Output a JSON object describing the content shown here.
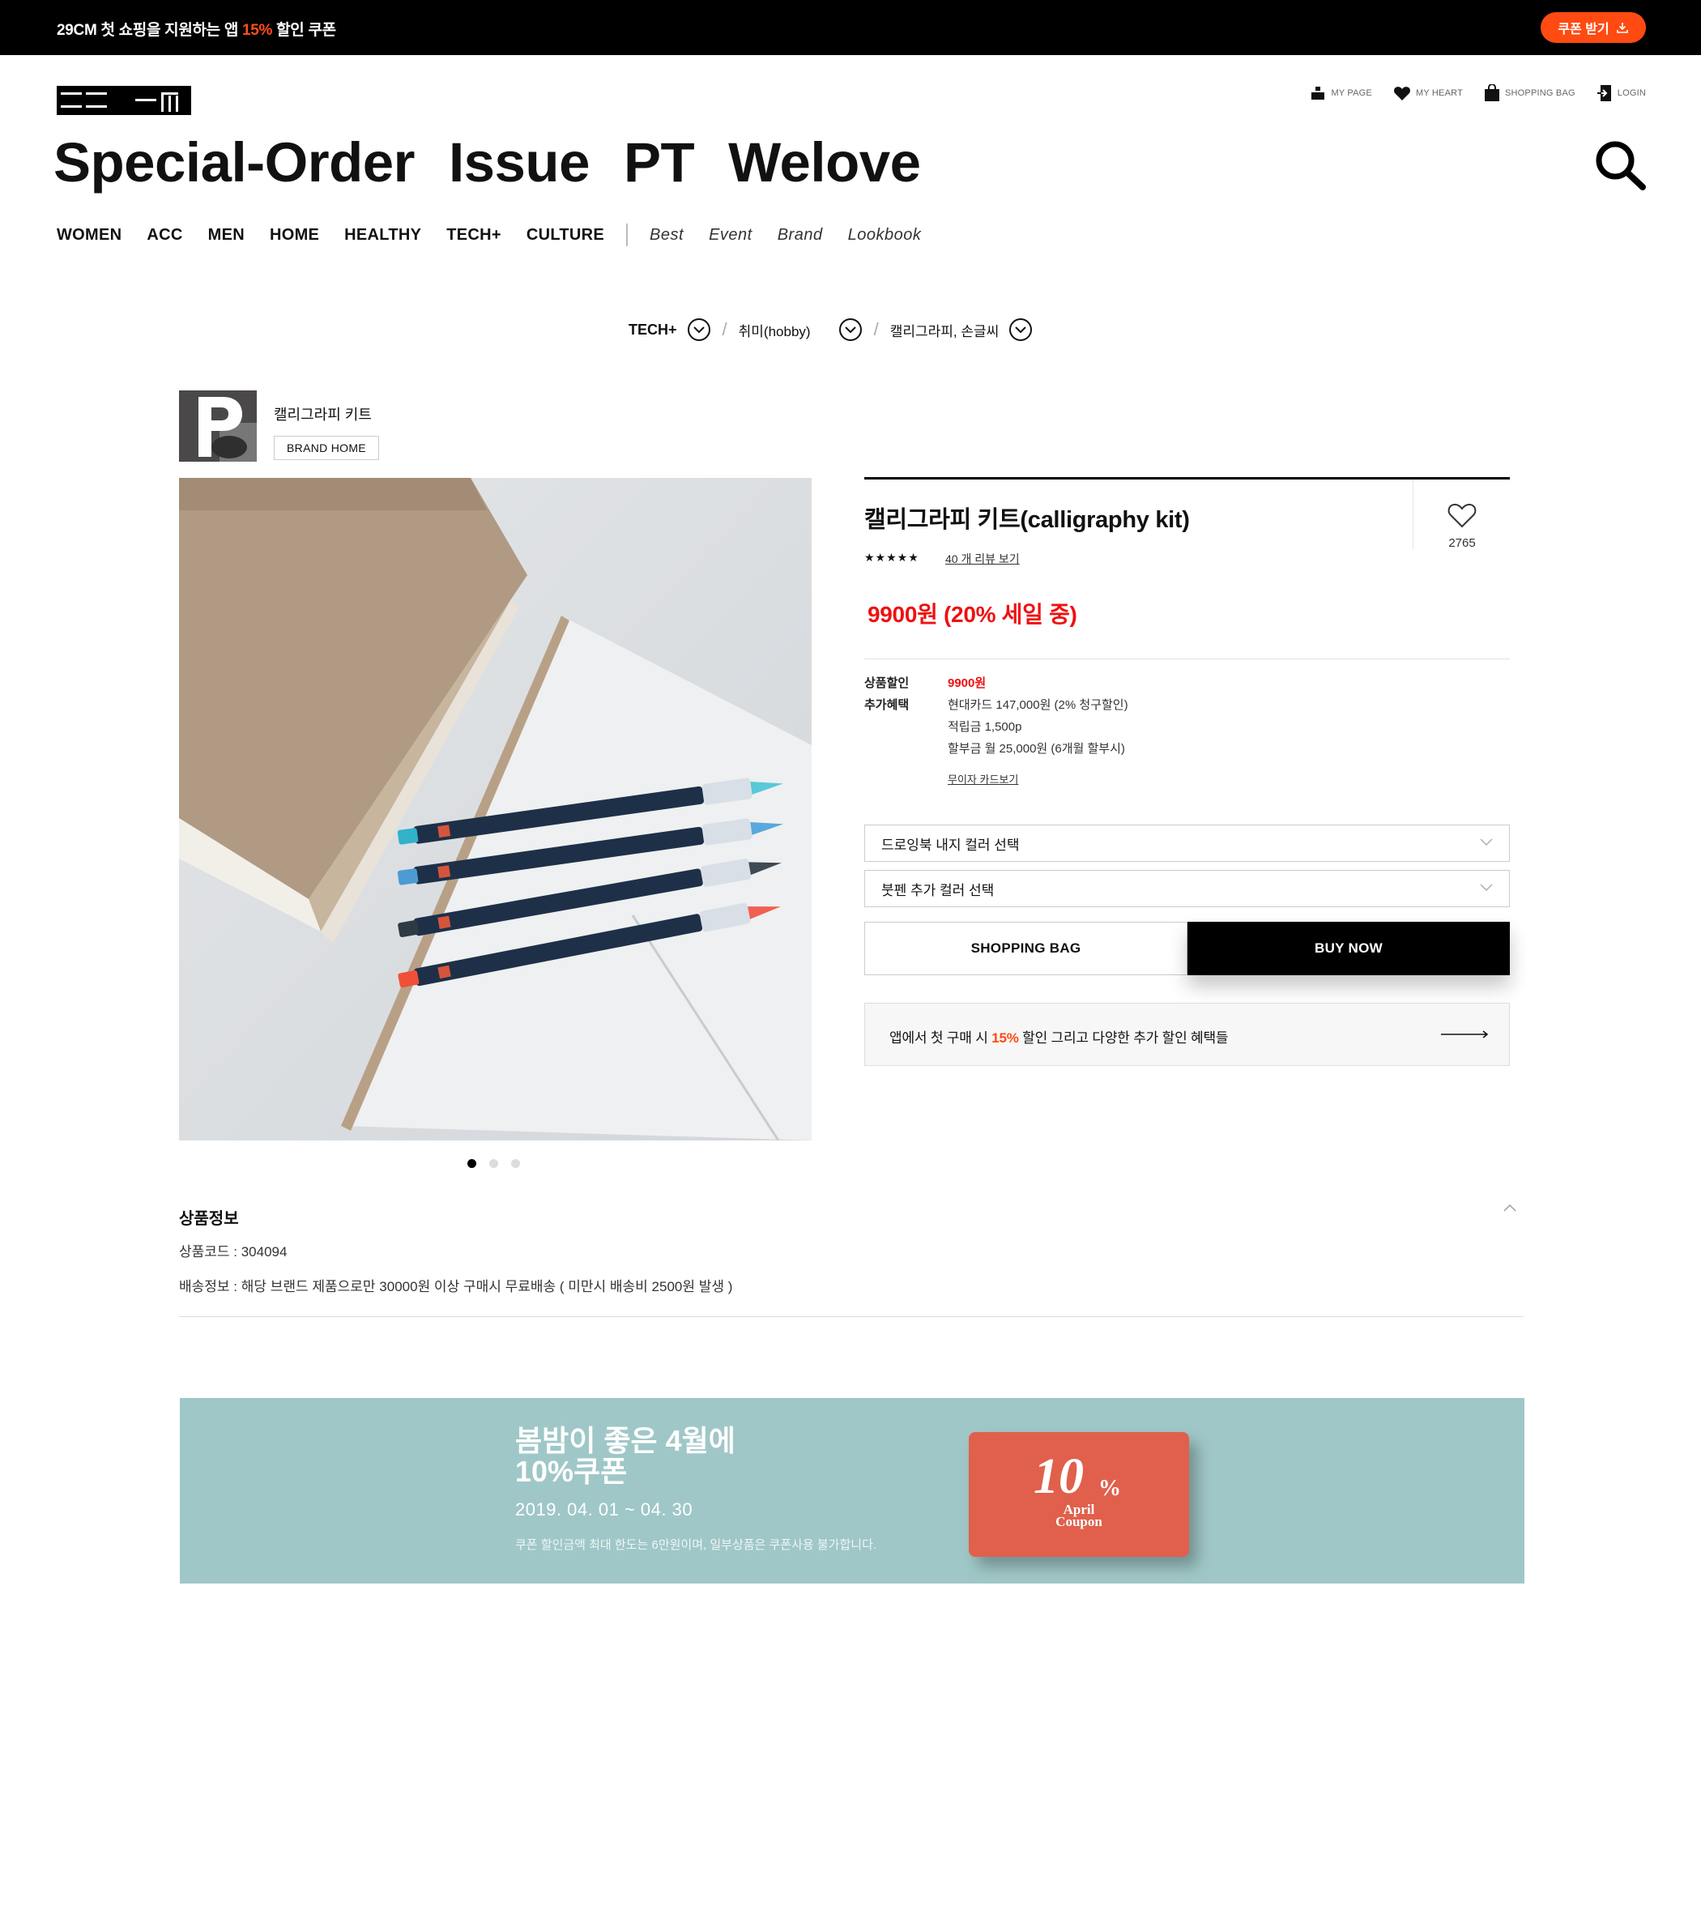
{
  "promo": {
    "text_a": "29CM 첫 쇼핑을 지원하는 앱 ",
    "text_hl": "15%",
    "text_b": " 할인 쿠폰",
    "button_label": "쿠폰 받기"
  },
  "util_nav": [
    {
      "label": "MY PAGE",
      "icon": "person-icon"
    },
    {
      "label": "MY HEART",
      "icon": "heart-icon"
    },
    {
      "label": "SHOPPING BAG",
      "icon": "bag-icon"
    },
    {
      "label": "LOGIN",
      "icon": "login-icon"
    }
  ],
  "big_nav": [
    "Special-Order",
    "Issue",
    "PT",
    "Welove"
  ],
  "categories": [
    "WOMEN",
    "ACC",
    "MEN",
    "HOME",
    "HEALTHY",
    "TECH+",
    "CULTURE"
  ],
  "sub_categories": [
    "Best",
    "Event",
    "Brand",
    "Lookbook"
  ],
  "breadcrumb": [
    "TECH+",
    "취미(hobby)",
    "캘리그라피, 손글씨"
  ],
  "brand": {
    "name": "캘리그라피 키트",
    "home_label": "BRAND HOME"
  },
  "product": {
    "title": "캘리그라피 키트(calligraphy kit)",
    "heart_count": "2765",
    "stars": "★★★★★",
    "review_link": "40 개 리뷰 보기",
    "sale_price": "9900원 (20% 세일 중)",
    "discount_label": "상품할인",
    "discount_value": "9900원",
    "benefit_label": "추가혜택",
    "benefits": [
      "현대카드 147,000원 (2% 청구할인)",
      "적립금 1,500p",
      "할부금 월 25,000원 (6개월 할부시)"
    ],
    "card_link": "무이자 카드보기",
    "option1": "드로잉북 내지 컬러 선택",
    "option2": "붓펜 추가 컬러 선택",
    "bag_label": "SHOPPING BAG",
    "buy_label": "BUY NOW",
    "app_banner_a": "앱에서 첫 구매 시 ",
    "app_banner_hl": "15%",
    "app_banner_b": " 할인 그리고 다양한 추가 할인 혜택들",
    "image_slides": 3,
    "active_slide": 1
  },
  "product_info": {
    "title": "상품정보",
    "code": "상품코드 : 304094",
    "shipping": "배송정보 : 해당 브랜드 제품으로만 30000원 이상 구매시 무료배송 ( 미만시 배송비 2500원 발생 )"
  },
  "coupon": {
    "headline1": "봄밤이 좋은 4월에",
    "headline2": "10%쿠폰",
    "dates": "2019. 04. 01 ~ 04. 30",
    "note": "쿠폰 할인금액 최대 한도는 6만원이며, 일부상품은 쿠폰사용 불가합니다.",
    "card_pct": "10",
    "card_pct_sign": "%",
    "card_sub1": "April",
    "card_sub2": "Coupon",
    "accent_color": "#e0604c",
    "bg_color": "#a0c7c7"
  },
  "colors": {
    "promo_accent": "#ff4a12",
    "price_red": "#ef1111"
  }
}
